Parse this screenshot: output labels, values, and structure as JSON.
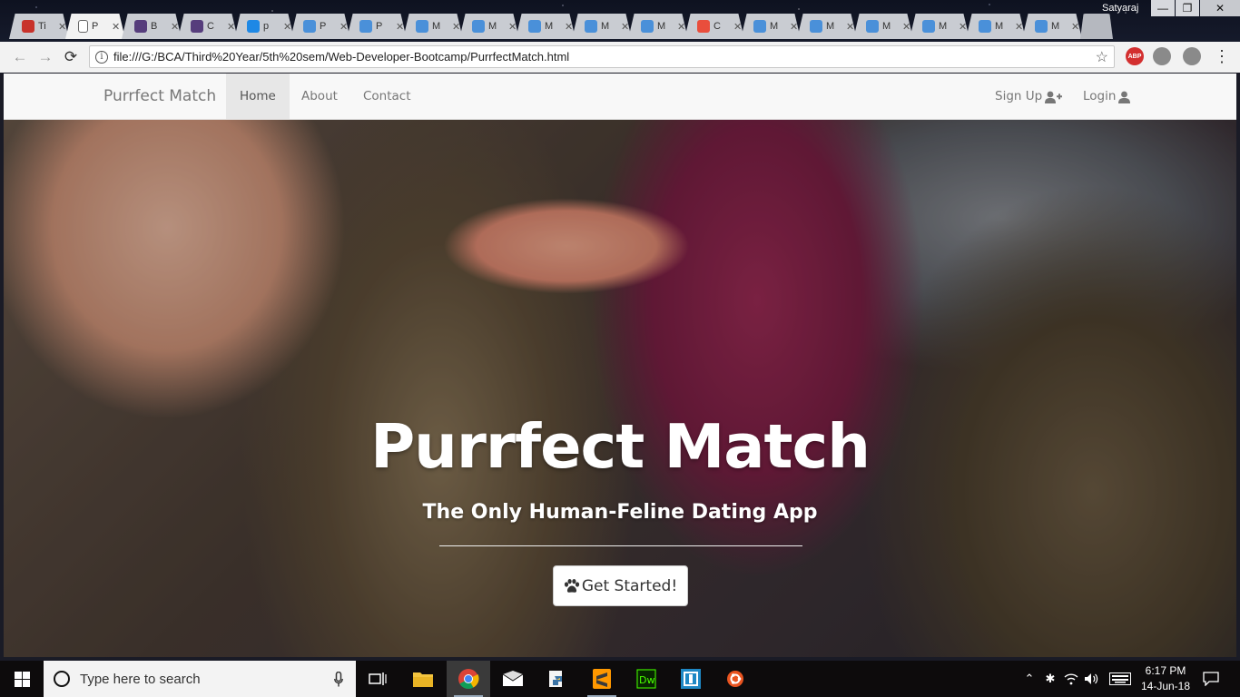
{
  "browser": {
    "tabs": [
      {
        "label": "Ti",
        "favicon": "acrobat-icon",
        "color": "#c8322b"
      },
      {
        "label": "P",
        "favicon": "page-icon",
        "color": "#ffffff",
        "active": true
      },
      {
        "label": "B",
        "favicon": "bootstrap-icon",
        "color": "#563d7c"
      },
      {
        "label": "C",
        "favicon": "bootstrap-icon",
        "color": "#563d7c"
      },
      {
        "label": "p",
        "favicon": "flag-icon",
        "color": "#1e88e5"
      },
      {
        "label": "P",
        "favicon": "infinity-icon",
        "color": "#4a90d9"
      },
      {
        "label": "P",
        "favicon": "infinity-icon",
        "color": "#4a90d9"
      },
      {
        "label": "M",
        "favicon": "infinity-icon",
        "color": "#4a90d9"
      },
      {
        "label": "M",
        "favicon": "infinity-icon",
        "color": "#4a90d9"
      },
      {
        "label": "M",
        "favicon": "infinity-icon",
        "color": "#4a90d9"
      },
      {
        "label": "M",
        "favicon": "infinity-icon",
        "color": "#4a90d9"
      },
      {
        "label": "M",
        "favicon": "infinity-icon",
        "color": "#4a90d9"
      },
      {
        "label": "C",
        "favicon": "colorful-icon",
        "color": "#e94e3c"
      },
      {
        "label": "M",
        "favicon": "infinity-icon",
        "color": "#4a90d9"
      },
      {
        "label": "M",
        "favicon": "infinity-icon",
        "color": "#4a90d9"
      },
      {
        "label": "M",
        "favicon": "infinity-icon",
        "color": "#4a90d9"
      },
      {
        "label": "M",
        "favicon": "infinity-icon",
        "color": "#4a90d9"
      },
      {
        "label": "M",
        "favicon": "infinity-icon",
        "color": "#4a90d9"
      },
      {
        "label": "M",
        "favicon": "infinity-icon",
        "color": "#4a90d9"
      }
    ],
    "tab_close_glyph": "✕",
    "profile_name": "Satyaraj",
    "window_controls": {
      "minimize": "—",
      "maximize": "❐",
      "close": "✕"
    },
    "nav": {
      "back": "←",
      "forward": "→",
      "reload": "⟳"
    },
    "url": "file:///G:/BCA/Third%20Year/5th%20sem/Web-Developer-Bootcamp/PurrfectMatch.html",
    "info_glyph": "i",
    "bookmark_glyph": "☆",
    "extensions": {
      "abp_label": "ABP",
      "menu_glyph": "⋮"
    }
  },
  "page": {
    "brand": "Purrfect Match",
    "nav_links": {
      "home": "Home",
      "about": "About",
      "contact": "Contact"
    },
    "nav_right": {
      "signup": "Sign Up",
      "login": "Login"
    },
    "hero_title": "Purrfect Match",
    "hero_subtitle": "The Only Human-Feline Dating App",
    "cta_label": "Get Started!"
  },
  "taskbar": {
    "search_placeholder": "Type here to search",
    "clock_time": "6:17 PM",
    "clock_date": "14-Jun-18",
    "pinned": [
      "task-view-icon",
      "file-explorer-icon",
      "chrome-icon",
      "mail-icon",
      "python-icon",
      "sublime-text-icon",
      "dreamweaver-icon",
      "brackets-icon",
      "ubuntu-icon"
    ]
  },
  "colors": {
    "navbar_bg": "#f8f8f8",
    "nav_text": "#777777",
    "hero_text": "#ffffff",
    "taskbar_bg": "#0d0b0c"
  }
}
